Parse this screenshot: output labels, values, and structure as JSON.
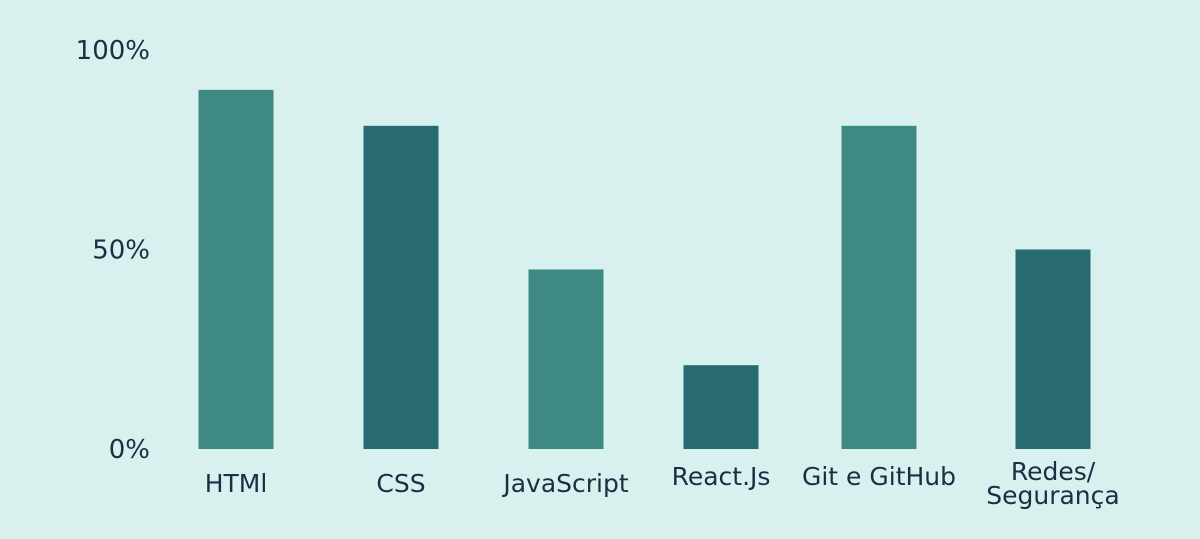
{
  "chart_data": {
    "type": "bar",
    "categories": [
      "HTMl",
      "CSS",
      "JavaScript",
      "React.Js",
      "Git e GitHub",
      "Redes/\nSegurança"
    ],
    "values": [
      90,
      81,
      45,
      21,
      81,
      50
    ],
    "y_ticks": [
      "0%",
      "50%",
      "100%"
    ],
    "ylim": [
      0,
      100
    ],
    "grid": false,
    "legend": "none",
    "colors": {
      "background": "#d8f1ee",
      "bar_light": "#3e8a82",
      "bar_dark": "#276a70",
      "text": "#1d2d44"
    },
    "bar_colors": [
      "#3e8a82",
      "#276a70",
      "#3e8a82",
      "#276a70",
      "#3e8a82",
      "#276a70"
    ]
  }
}
